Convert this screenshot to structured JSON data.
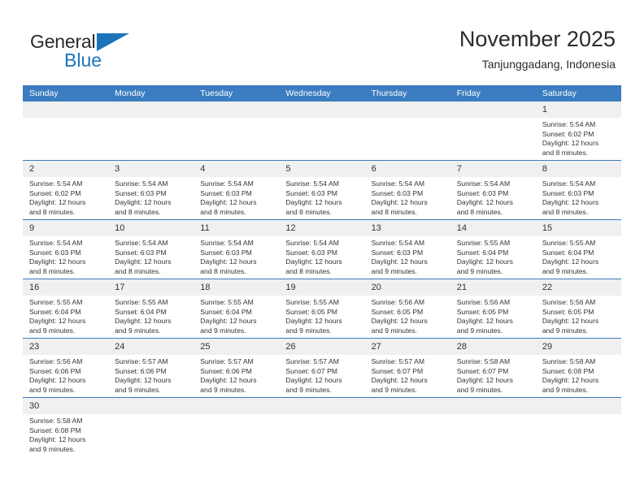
{
  "brand": {
    "line1": "General",
    "line2": "Blue",
    "flag_icon": "blue-triangle-flag",
    "color_dark": "#2b2b2b",
    "color_blue": "#1b74bb"
  },
  "header": {
    "title": "November 2025",
    "subtitle": "Tanjunggadang, Indonesia"
  },
  "theme": {
    "header_blue": "#3b7dc0",
    "daynum_band": "#f0f0f0",
    "text": "#333333"
  },
  "calendar": {
    "weekday_headers": [
      "Sunday",
      "Monday",
      "Tuesday",
      "Wednesday",
      "Thursday",
      "Friday",
      "Saturday"
    ],
    "labels": {
      "sunrise": "Sunrise:",
      "sunset": "Sunset:",
      "daylight": "Daylight:"
    },
    "weeks": [
      [
        {
          "day": "",
          "empty": true
        },
        {
          "day": "",
          "empty": true
        },
        {
          "day": "",
          "empty": true
        },
        {
          "day": "",
          "empty": true
        },
        {
          "day": "",
          "empty": true
        },
        {
          "day": "",
          "empty": true
        },
        {
          "day": "1",
          "sunrise": "Sunrise: 5:54 AM",
          "sunset": "Sunset: 6:02 PM",
          "daylight_l1": "Daylight: 12 hours",
          "daylight_l2": "and 8 minutes."
        }
      ],
      [
        {
          "day": "2",
          "sunrise": "Sunrise: 5:54 AM",
          "sunset": "Sunset: 6:02 PM",
          "daylight_l1": "Daylight: 12 hours",
          "daylight_l2": "and 8 minutes."
        },
        {
          "day": "3",
          "sunrise": "Sunrise: 5:54 AM",
          "sunset": "Sunset: 6:03 PM",
          "daylight_l1": "Daylight: 12 hours",
          "daylight_l2": "and 8 minutes."
        },
        {
          "day": "4",
          "sunrise": "Sunrise: 5:54 AM",
          "sunset": "Sunset: 6:03 PM",
          "daylight_l1": "Daylight: 12 hours",
          "daylight_l2": "and 8 minutes."
        },
        {
          "day": "5",
          "sunrise": "Sunrise: 5:54 AM",
          "sunset": "Sunset: 6:03 PM",
          "daylight_l1": "Daylight: 12 hours",
          "daylight_l2": "and 8 minutes."
        },
        {
          "day": "6",
          "sunrise": "Sunrise: 5:54 AM",
          "sunset": "Sunset: 6:03 PM",
          "daylight_l1": "Daylight: 12 hours",
          "daylight_l2": "and 8 minutes."
        },
        {
          "day": "7",
          "sunrise": "Sunrise: 5:54 AM",
          "sunset": "Sunset: 6:03 PM",
          "daylight_l1": "Daylight: 12 hours",
          "daylight_l2": "and 8 minutes."
        },
        {
          "day": "8",
          "sunrise": "Sunrise: 5:54 AM",
          "sunset": "Sunset: 6:03 PM",
          "daylight_l1": "Daylight: 12 hours",
          "daylight_l2": "and 8 minutes."
        }
      ],
      [
        {
          "day": "9",
          "sunrise": "Sunrise: 5:54 AM",
          "sunset": "Sunset: 6:03 PM",
          "daylight_l1": "Daylight: 12 hours",
          "daylight_l2": "and 8 minutes."
        },
        {
          "day": "10",
          "sunrise": "Sunrise: 5:54 AM",
          "sunset": "Sunset: 6:03 PM",
          "daylight_l1": "Daylight: 12 hours",
          "daylight_l2": "and 8 minutes."
        },
        {
          "day": "11",
          "sunrise": "Sunrise: 5:54 AM",
          "sunset": "Sunset: 6:03 PM",
          "daylight_l1": "Daylight: 12 hours",
          "daylight_l2": "and 8 minutes."
        },
        {
          "day": "12",
          "sunrise": "Sunrise: 5:54 AM",
          "sunset": "Sunset: 6:03 PM",
          "daylight_l1": "Daylight: 12 hours",
          "daylight_l2": "and 8 minutes."
        },
        {
          "day": "13",
          "sunrise": "Sunrise: 5:54 AM",
          "sunset": "Sunset: 6:03 PM",
          "daylight_l1": "Daylight: 12 hours",
          "daylight_l2": "and 9 minutes."
        },
        {
          "day": "14",
          "sunrise": "Sunrise: 5:55 AM",
          "sunset": "Sunset: 6:04 PM",
          "daylight_l1": "Daylight: 12 hours",
          "daylight_l2": "and 9 minutes."
        },
        {
          "day": "15",
          "sunrise": "Sunrise: 5:55 AM",
          "sunset": "Sunset: 6:04 PM",
          "daylight_l1": "Daylight: 12 hours",
          "daylight_l2": "and 9 minutes."
        }
      ],
      [
        {
          "day": "16",
          "sunrise": "Sunrise: 5:55 AM",
          "sunset": "Sunset: 6:04 PM",
          "daylight_l1": "Daylight: 12 hours",
          "daylight_l2": "and 9 minutes."
        },
        {
          "day": "17",
          "sunrise": "Sunrise: 5:55 AM",
          "sunset": "Sunset: 6:04 PM",
          "daylight_l1": "Daylight: 12 hours",
          "daylight_l2": "and 9 minutes."
        },
        {
          "day": "18",
          "sunrise": "Sunrise: 5:55 AM",
          "sunset": "Sunset: 6:04 PM",
          "daylight_l1": "Daylight: 12 hours",
          "daylight_l2": "and 9 minutes."
        },
        {
          "day": "19",
          "sunrise": "Sunrise: 5:55 AM",
          "sunset": "Sunset: 6:05 PM",
          "daylight_l1": "Daylight: 12 hours",
          "daylight_l2": "and 9 minutes."
        },
        {
          "day": "20",
          "sunrise": "Sunrise: 5:56 AM",
          "sunset": "Sunset: 6:05 PM",
          "daylight_l1": "Daylight: 12 hours",
          "daylight_l2": "and 9 minutes."
        },
        {
          "day": "21",
          "sunrise": "Sunrise: 5:56 AM",
          "sunset": "Sunset: 6:05 PM",
          "daylight_l1": "Daylight: 12 hours",
          "daylight_l2": "and 9 minutes."
        },
        {
          "day": "22",
          "sunrise": "Sunrise: 5:56 AM",
          "sunset": "Sunset: 6:05 PM",
          "daylight_l1": "Daylight: 12 hours",
          "daylight_l2": "and 9 minutes."
        }
      ],
      [
        {
          "day": "23",
          "sunrise": "Sunrise: 5:56 AM",
          "sunset": "Sunset: 6:06 PM",
          "daylight_l1": "Daylight: 12 hours",
          "daylight_l2": "and 9 minutes."
        },
        {
          "day": "24",
          "sunrise": "Sunrise: 5:57 AM",
          "sunset": "Sunset: 6:06 PM",
          "daylight_l1": "Daylight: 12 hours",
          "daylight_l2": "and 9 minutes."
        },
        {
          "day": "25",
          "sunrise": "Sunrise: 5:57 AM",
          "sunset": "Sunset: 6:06 PM",
          "daylight_l1": "Daylight: 12 hours",
          "daylight_l2": "and 9 minutes."
        },
        {
          "day": "26",
          "sunrise": "Sunrise: 5:57 AM",
          "sunset": "Sunset: 6:07 PM",
          "daylight_l1": "Daylight: 12 hours",
          "daylight_l2": "and 9 minutes."
        },
        {
          "day": "27",
          "sunrise": "Sunrise: 5:57 AM",
          "sunset": "Sunset: 6:07 PM",
          "daylight_l1": "Daylight: 12 hours",
          "daylight_l2": "and 9 minutes."
        },
        {
          "day": "28",
          "sunrise": "Sunrise: 5:58 AM",
          "sunset": "Sunset: 6:07 PM",
          "daylight_l1": "Daylight: 12 hours",
          "daylight_l2": "and 9 minutes."
        },
        {
          "day": "29",
          "sunrise": "Sunrise: 5:58 AM",
          "sunset": "Sunset: 6:08 PM",
          "daylight_l1": "Daylight: 12 hours",
          "daylight_l2": "and 9 minutes."
        }
      ],
      [
        {
          "day": "30",
          "sunrise": "Sunrise: 5:58 AM",
          "sunset": "Sunset: 6:08 PM",
          "daylight_l1": "Daylight: 12 hours",
          "daylight_l2": "and 9 minutes."
        },
        {
          "day": "",
          "empty": true
        },
        {
          "day": "",
          "empty": true
        },
        {
          "day": "",
          "empty": true
        },
        {
          "day": "",
          "empty": true
        },
        {
          "day": "",
          "empty": true
        },
        {
          "day": "",
          "empty": true
        }
      ]
    ]
  }
}
